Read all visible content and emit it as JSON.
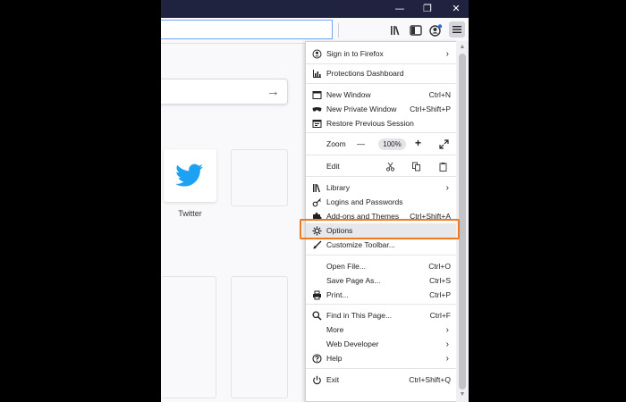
{
  "menu": {
    "items": {
      "sign_in": "Sign in to Firefox",
      "protections": "Protections Dashboard",
      "new_window": "New Window",
      "new_window_sc": "Ctrl+N",
      "new_private": "New Private Window",
      "new_private_sc": "Ctrl+Shift+P",
      "restore": "Restore Previous Session",
      "zoom": "Zoom",
      "zoom_minus": "—",
      "zoom_value": "100%",
      "zoom_plus": "+",
      "edit": "Edit",
      "library": "Library",
      "logins": "Logins and Passwords",
      "addons": "Add-ons and Themes",
      "addons_sc": "Ctrl+Shift+A",
      "options": "Options",
      "customize": "Customize Toolbar...",
      "open_file": "Open File...",
      "open_file_sc": "Ctrl+O",
      "save_page": "Save Page As...",
      "save_page_sc": "Ctrl+S",
      "print": "Print...",
      "print_sc": "Ctrl+P",
      "find": "Find in This Page...",
      "find_sc": "Ctrl+F",
      "more": "More",
      "web_dev": "Web Developer",
      "help": "Help",
      "exit": "Exit",
      "exit_sc": "Ctrl+Shift+Q"
    },
    "submenu_arrow": "›"
  },
  "window_controls": {
    "minimize": "—",
    "maximize": "❐",
    "close": "✕"
  },
  "newtab": {
    "search_arrow": "→",
    "twitter_label": "Twitter"
  },
  "icons": {
    "library": "library-icon",
    "sidebar": "sidebar-icon",
    "account": "account-icon",
    "menu": "hamburger-menu-icon"
  },
  "colors": {
    "titlebar": "#202340",
    "highlight_outline": "#f0781e",
    "twitter_blue": "#1da1f2"
  }
}
